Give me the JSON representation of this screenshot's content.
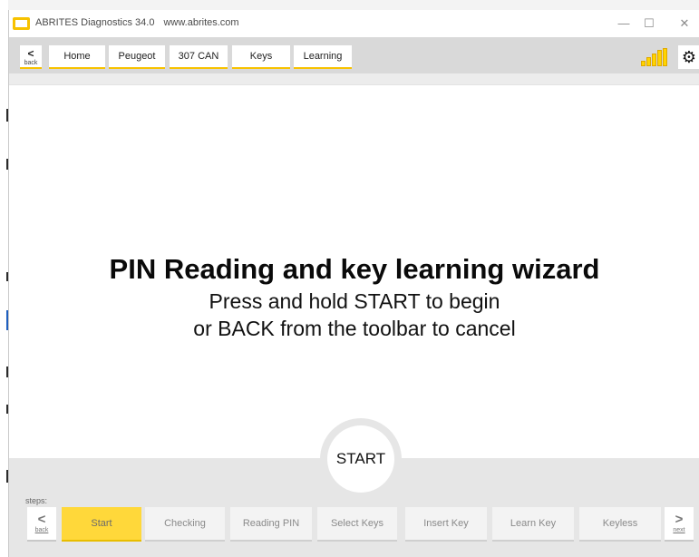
{
  "window": {
    "app_title": "ABRITES Diagnostics 34.0",
    "url": "www.abrites.com",
    "minimize": "—",
    "maximize": "☐",
    "close": "✕"
  },
  "toolbar": {
    "back_label": "back",
    "back_glyph": "<",
    "breadcrumbs": [
      "Home",
      "Peugeot",
      "307 CAN",
      "Keys",
      "Learning"
    ],
    "signal_icon": "signal-bars-icon",
    "settings_glyph": "⚙",
    "accent_color": "#f7c200"
  },
  "wizard": {
    "title": "PIN Reading and key learning wizard",
    "line1": "Press and hold START to begin",
    "line2": "or BACK from the toolbar to cancel",
    "start_label": "START"
  },
  "steps": {
    "label": "steps:",
    "back_label": "back",
    "next_label": "next",
    "back_glyph": "<",
    "next_glyph": ">",
    "active_index": 0,
    "items": [
      "Start",
      "Checking",
      "Reading PIN",
      "Select Keys",
      "Insert Key",
      "Learn Key",
      "Keyless"
    ]
  }
}
